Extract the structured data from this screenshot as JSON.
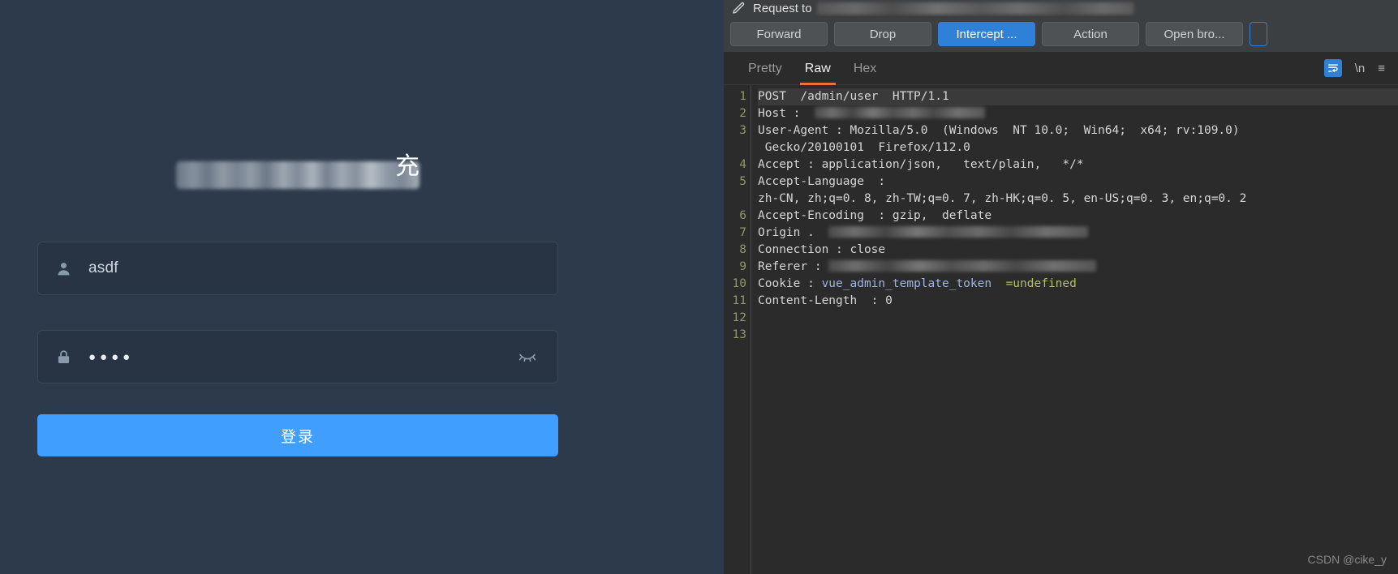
{
  "login": {
    "title_redacted": "",
    "title_visible_char": "充",
    "username": {
      "value": "asdf",
      "icon": "user-icon"
    },
    "password": {
      "value": "●●●●",
      "icon": "lock-icon",
      "toggle_icon": "eye-off-icon"
    },
    "submit_label": "登录",
    "colors": {
      "background": "#2d3a4b",
      "field": "#283443",
      "accent": "#409eff"
    }
  },
  "burp": {
    "header": {
      "icon": "pencil-icon",
      "title": "Request to"
    },
    "toolbar": {
      "buttons": [
        {
          "label": "Forward",
          "name": "forward-button",
          "style": "default"
        },
        {
          "label": "Drop",
          "name": "drop-button",
          "style": "default"
        },
        {
          "label": "Intercept ...",
          "name": "intercept-toggle-button",
          "style": "primary"
        },
        {
          "label": "Action",
          "name": "action-button",
          "style": "default"
        },
        {
          "label": "Open bro...",
          "name": "open-browser-button",
          "style": "default"
        }
      ]
    },
    "view_tabs": [
      {
        "label": "Pretty",
        "active": false
      },
      {
        "label": "Raw",
        "active": true
      },
      {
        "label": "Hex",
        "active": false
      }
    ],
    "tab_icons": [
      {
        "name": "wrap-lines-icon",
        "glyph": "≡",
        "boxed": true
      },
      {
        "name": "newline-icon",
        "glyph": "\\n",
        "boxed": false
      },
      {
        "name": "menu-icon",
        "glyph": "≡",
        "boxed": false
      }
    ],
    "request": {
      "line_numbers": [
        "1",
        "2",
        "3",
        "",
        "4",
        "5",
        "",
        "6",
        "7",
        "8",
        "9",
        "10",
        "11",
        "12",
        "13"
      ],
      "lines": [
        {
          "n": "1",
          "type": "plain",
          "text": "POST  /admin/user  HTTP/1.1",
          "highlight": true
        },
        {
          "n": "2",
          "type": "redacted",
          "prefix": "Host :  ",
          "redact": "host"
        },
        {
          "n": "3",
          "type": "plain",
          "text": "User-Agent : Mozilla/5.0  (Windows  NT 10.0;  Win64;  x64; rv:109.0)"
        },
        {
          "n": "",
          "type": "plain",
          "text": " Gecko/20100101  Firefox/112.0"
        },
        {
          "n": "4",
          "type": "plain",
          "text": "Accept : application/json,   text/plain,   */*"
        },
        {
          "n": "5",
          "type": "plain",
          "text": "Accept-Language  :"
        },
        {
          "n": "",
          "type": "plain",
          "text": "zh-CN, zh;q=0. 8, zh-TW;q=0. 7, zh-HK;q=0. 5, en-US;q=0. 3, en;q=0. 2"
        },
        {
          "n": "6",
          "type": "plain",
          "text": "Accept-Encoding  : gzip,  deflate"
        },
        {
          "n": "7",
          "type": "redacted",
          "prefix": "Origin .  ",
          "redact": "origin"
        },
        {
          "n": "8",
          "type": "plain",
          "text": "Connection : close"
        },
        {
          "n": "9",
          "type": "redacted",
          "prefix": "Referer : ",
          "redact": "referer"
        },
        {
          "n": "10",
          "type": "cookie",
          "prefix": "Cookie : ",
          "cookie_name": "vue_admin_template_token",
          "cookie_value": "=undefined"
        },
        {
          "n": "11",
          "type": "plain",
          "text": "Content-Length  : 0"
        },
        {
          "n": "12",
          "type": "plain",
          "text": ""
        },
        {
          "n": "13",
          "type": "plain",
          "text": ""
        }
      ]
    }
  },
  "watermark": "CSDN @cike_y"
}
